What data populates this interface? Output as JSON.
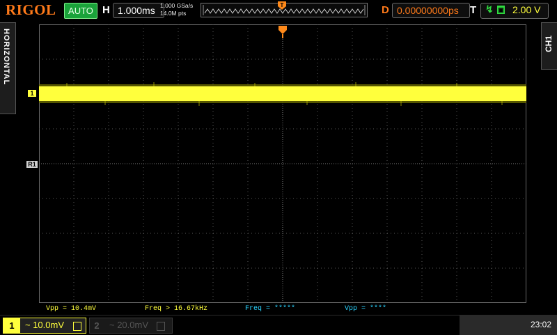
{
  "topbar": {
    "brand": "RIGOL",
    "run_mode": "AUTO",
    "horizontal_label": "H",
    "timebase": "1.000ms",
    "sample_rate": "1.000 GSa/s",
    "memory_depth": "14.0M pts",
    "delay_label": "D",
    "delay_value": "0.00000000ps",
    "trigger_label": "T",
    "trigger_level": "2.00 V",
    "trigger_top_marker": "T"
  },
  "side": {
    "left_tab": "HORIZONTAL",
    "right_tab": "CH1"
  },
  "markers": {
    "ch1": "1",
    "ref1": "R1"
  },
  "measurements": [
    {
      "text": "Vpp = 10.4mV",
      "color": "#ffff3c"
    },
    {
      "text": "Freq > 16.67kHz",
      "color": "#ffff3c"
    },
    {
      "text": "Freq = *****",
      "color": "#2ad4ff"
    },
    {
      "text": "Vpp = ****",
      "color": "#2ad4ff"
    }
  ],
  "channels": [
    {
      "num": "1",
      "value": "~ 10.0mV",
      "color": "#ffff3c"
    },
    {
      "num": "2",
      "value": "~ 20.0mV",
      "color": "#555555"
    }
  ],
  "clock": "23:02",
  "icons": {
    "trigger_slope": "rising-edge-icon",
    "trigger_source": "source-icon",
    "memory": "waveform-memory-icon",
    "bandwidth": "bw-limit-icon"
  }
}
